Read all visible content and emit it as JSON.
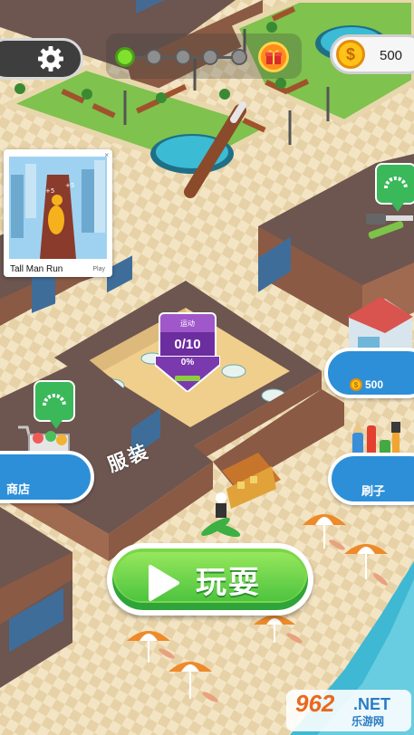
{
  "hud": {
    "coins": "500",
    "level_dots": 5,
    "level_current": 1,
    "settings_icon": "gear-icon",
    "reward_icon": "gift-icon"
  },
  "ad": {
    "title": "Tall Man Run",
    "cta": "Play",
    "close": "×"
  },
  "task": {
    "header": "运动",
    "count": "0/10",
    "percent": "0%"
  },
  "buttons": {
    "shop": "商店",
    "brush": "刷子",
    "upgrade_cost": "500",
    "play": "玩耍"
  },
  "map_labels": {
    "clothes": "服装"
  },
  "watermark": {
    "logo": "962",
    "net": ".NET",
    "site": "乐游网"
  },
  "colors": {
    "floor_beige": "#f1e2c0",
    "wall_brown": "#8a5a44",
    "roof_dark": "#6d5550",
    "grass": "#7fc24d",
    "pool_water": "#3cbbd5",
    "primary_blue": "#2d8fd8",
    "play_green": "#6bd14a",
    "task_purple": "#7a3aae"
  }
}
